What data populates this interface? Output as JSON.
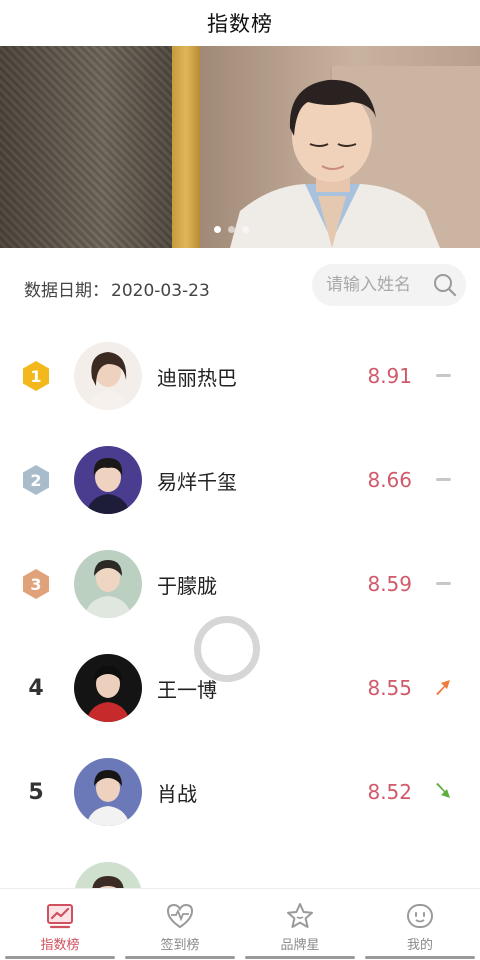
{
  "header": {
    "title": "指数榜"
  },
  "banner": {
    "slides": 3,
    "active_slide": 1
  },
  "filter": {
    "date_label": "数据日期：",
    "date_value": "2020-03-23",
    "search_placeholder": "请输入姓名"
  },
  "ranking": [
    {
      "rank": "1",
      "badge": "gold",
      "name": "迪丽热巴",
      "score": "8.91",
      "trend": "flat"
    },
    {
      "rank": "2",
      "badge": "silver",
      "name": "易烊千玺",
      "score": "8.66",
      "trend": "flat"
    },
    {
      "rank": "3",
      "badge": "bronze",
      "name": "于朦胧",
      "score": "8.59",
      "trend": "flat"
    },
    {
      "rank": "4",
      "badge": "none",
      "name": "王一博",
      "score": "8.55",
      "trend": "up"
    },
    {
      "rank": "5",
      "badge": "none",
      "name": "肖战",
      "score": "8.52",
      "trend": "down"
    }
  ],
  "tabs": [
    {
      "label": "指数榜",
      "icon": "chart-icon",
      "active": true
    },
    {
      "label": "签到榜",
      "icon": "heartbeat-icon",
      "active": false
    },
    {
      "label": "品牌星",
      "icon": "star-icon",
      "active": false
    },
    {
      "label": "我的",
      "icon": "smile-icon",
      "active": false
    }
  ],
  "colors": {
    "accent": "#d0505f",
    "score": "#d05a6a",
    "gold": "#f2b81c",
    "silver": "#a9bccb",
    "bronze": "#e0a27a",
    "up": "#f07a3a",
    "down": "#5fae3e"
  }
}
